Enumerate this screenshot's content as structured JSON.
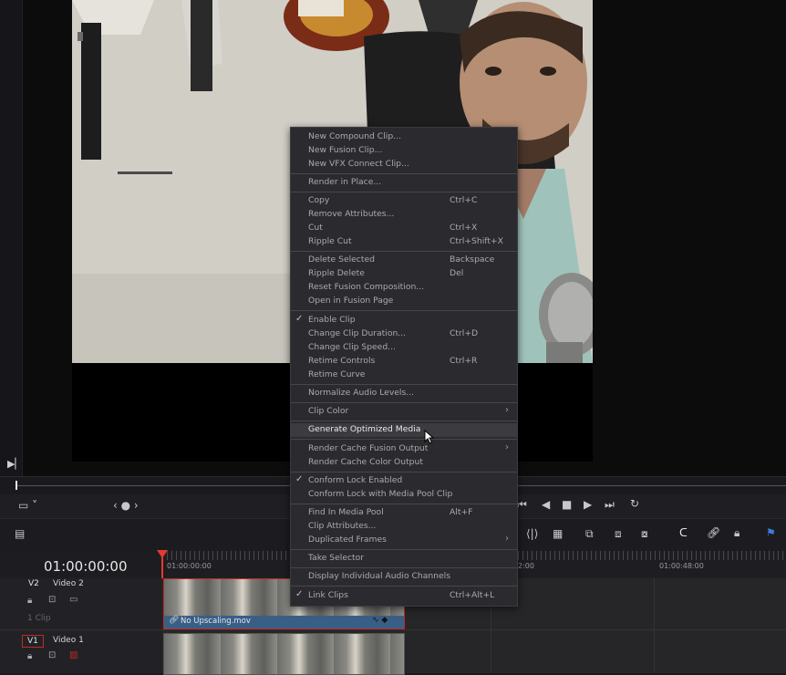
{
  "timecode": "01:00:00:00",
  "ruler": {
    "labels": [
      "01:00:00:00",
      "2:00",
      "01:00:48:00"
    ]
  },
  "tracks": [
    {
      "code": "V2",
      "name": "Video 2",
      "clip_count": "1 Clip",
      "clip_name": "No Upscaling.mov"
    },
    {
      "code": "V1",
      "name": "Video 1"
    }
  ],
  "context_menu": {
    "items": [
      {
        "label": "New Compound Clip...",
        "shortcut": ""
      },
      {
        "label": "New Fusion Clip...",
        "shortcut": ""
      },
      {
        "label": "New VFX Connect Clip...",
        "shortcut": ""
      },
      {
        "label": "Render in Place...",
        "shortcut": ""
      },
      {
        "label": "Copy",
        "shortcut": "Ctrl+C"
      },
      {
        "label": "Remove Attributes...",
        "shortcut": ""
      },
      {
        "label": "Cut",
        "shortcut": "Ctrl+X"
      },
      {
        "label": "Ripple Cut",
        "shortcut": "Ctrl+Shift+X"
      },
      {
        "label": "Delete Selected",
        "shortcut": "Backspace"
      },
      {
        "label": "Ripple Delete",
        "shortcut": "Del"
      },
      {
        "label": "Reset Fusion Composition...",
        "shortcut": ""
      },
      {
        "label": "Open in Fusion Page",
        "shortcut": ""
      },
      {
        "label": "Enable Clip",
        "shortcut": "",
        "checked": true
      },
      {
        "label": "Change Clip Duration...",
        "shortcut": "Ctrl+D"
      },
      {
        "label": "Change Clip Speed...",
        "shortcut": ""
      },
      {
        "label": "Retime Controls",
        "shortcut": "Ctrl+R"
      },
      {
        "label": "Retime Curve",
        "shortcut": ""
      },
      {
        "label": "Normalize Audio Levels...",
        "shortcut": ""
      },
      {
        "label": "Clip Color",
        "shortcut": "",
        "submenu": true
      },
      {
        "label": "Generate Optimized Media",
        "shortcut": "",
        "highlighted": true
      },
      {
        "label": "Render Cache Fusion Output",
        "shortcut": "",
        "submenu": true
      },
      {
        "label": "Render Cache Color Output",
        "shortcut": ""
      },
      {
        "label": "Conform Lock Enabled",
        "shortcut": "",
        "checked": true
      },
      {
        "label": "Conform Lock with Media Pool Clip",
        "shortcut": ""
      },
      {
        "label": "Find In Media Pool",
        "shortcut": "Alt+F"
      },
      {
        "label": "Clip Attributes...",
        "shortcut": ""
      },
      {
        "label": "Duplicated Frames",
        "shortcut": "",
        "submenu": true
      },
      {
        "label": "Take Selector",
        "shortcut": ""
      },
      {
        "label": "Display Individual Audio Channels",
        "shortcut": ""
      },
      {
        "label": "Link Clips",
        "shortcut": "Ctrl+Alt+L",
        "checked": true
      }
    ]
  },
  "icons": {
    "playback": [
      "go-to-start-icon",
      "play-reverse-icon",
      "stop-icon",
      "play-icon",
      "go-to-end-icon",
      "loop-icon"
    ],
    "toolbar": [
      "snapping-icon",
      "linked-selection-icon",
      "position-lock-icon",
      "flag-icon"
    ]
  },
  "colors": {
    "playhead": "#e23b2f",
    "clip_label_bar": "#3a5f86",
    "menu_bg": "#2b2b2f",
    "highlight": "#3b3b40"
  }
}
